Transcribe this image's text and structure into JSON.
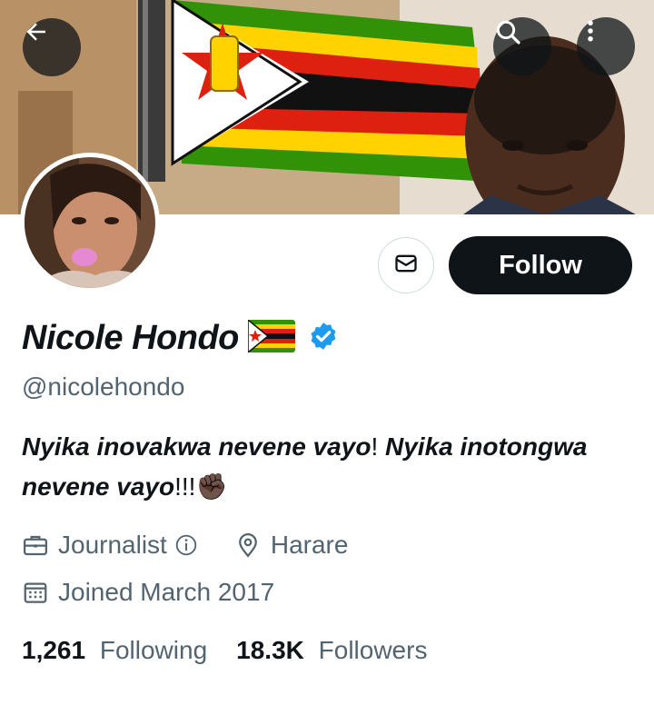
{
  "profile": {
    "name": "Nicole Hondo",
    "handle": "@nicolehondo",
    "bio_part1": "Nyika inovakwa nevene vayo",
    "bio_part2": "! ",
    "bio_part3": "Nyika inotongwa nevene vayo",
    "bio_part4": "!!!",
    "bio_emoji": "✊🏿",
    "profession": "Journalist",
    "location": "Harare",
    "joined": "Joined March 2017",
    "following_count": "1,261",
    "following_label": "Following",
    "followers_count": "18.3K",
    "followers_label": "Followers"
  },
  "buttons": {
    "follow": "Follow"
  },
  "icons": {
    "back": "arrow-left-icon",
    "search": "search-icon",
    "more": "more-vertical-icon",
    "message": "envelope-icon",
    "verified": "verified-badge-icon",
    "profession": "briefcase-icon",
    "location": "location-pin-icon",
    "joined": "calendar-icon"
  },
  "colors": {
    "verified_blue": "#1d9bf0",
    "follow_bg": "#0f1419",
    "secondary_text": "#536471"
  }
}
